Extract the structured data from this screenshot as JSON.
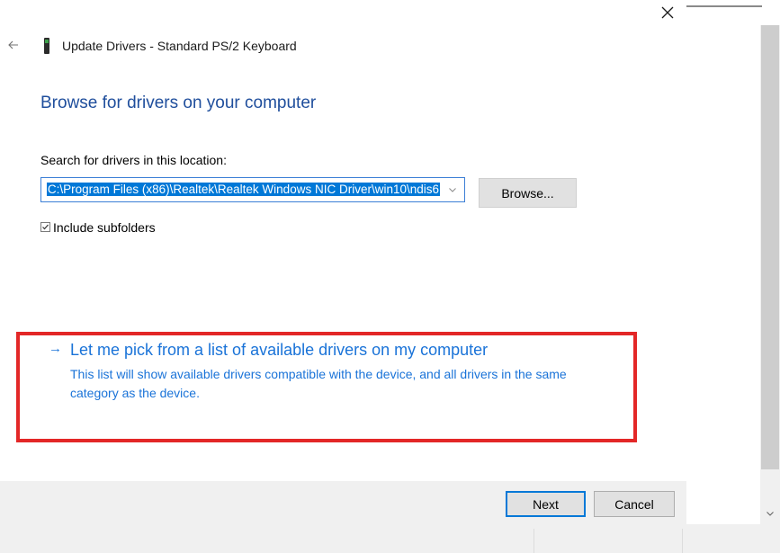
{
  "window": {
    "title": "Update Drivers - Standard PS/2 Keyboard",
    "close_icon": "close-icon",
    "back_icon": "back-arrow-icon",
    "device_icon": "keyboard-device-icon"
  },
  "page": {
    "heading": "Browse for drivers on your computer",
    "search_label": "Search for drivers in this location:",
    "path_value": "C:\\Program Files (x86)\\Realtek\\Realtek Windows NIC Driver\\win10\\ndis6",
    "browse_label": "Browse...",
    "include_subfolders_label": "Include subfolders",
    "include_subfolders_checked": true
  },
  "pick_option": {
    "arrow": "→",
    "label": "Let me pick from a list of available drivers on my computer",
    "description": "This list will show available drivers compatible with the device, and all drivers in the same category as the device."
  },
  "footer": {
    "next_label": "Next",
    "cancel_label": "Cancel"
  },
  "colors": {
    "accent": "#0078d7",
    "link": "#1a73d8",
    "heading": "#1f4e9c",
    "highlight": "#e32727"
  }
}
